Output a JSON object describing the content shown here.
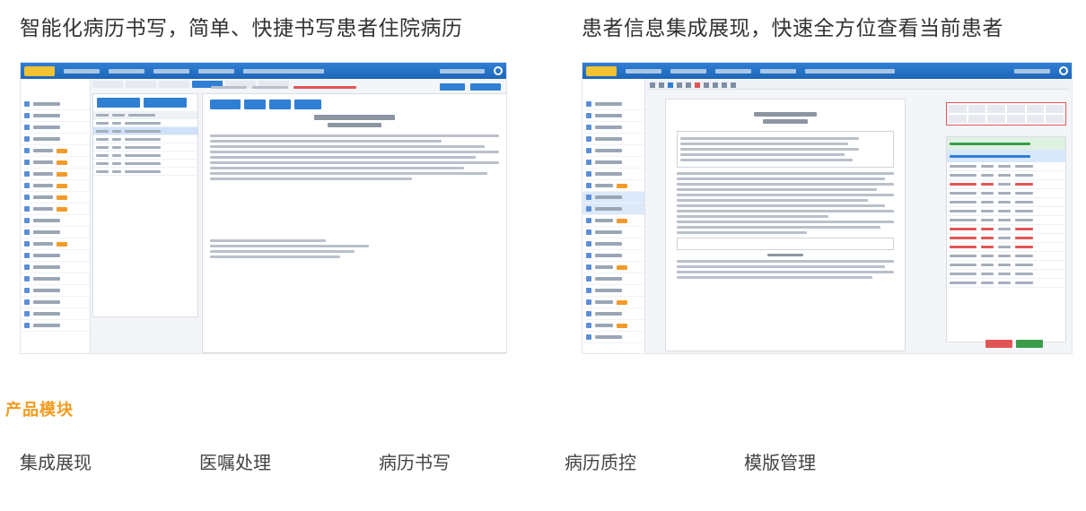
{
  "headings": {
    "left": "智能化病历书写，简单、快捷书写患者住院病历",
    "right": "患者信息集成展现，快速全方位查看当前患者"
  },
  "section_title": "产品模块",
  "modules": [
    "集成展现",
    "医嘱处理",
    "病历书写",
    "病历质控",
    "模版管理"
  ],
  "colors": {
    "accent_orange": "#f29a1e",
    "app_blue": "#2f7fd4"
  }
}
